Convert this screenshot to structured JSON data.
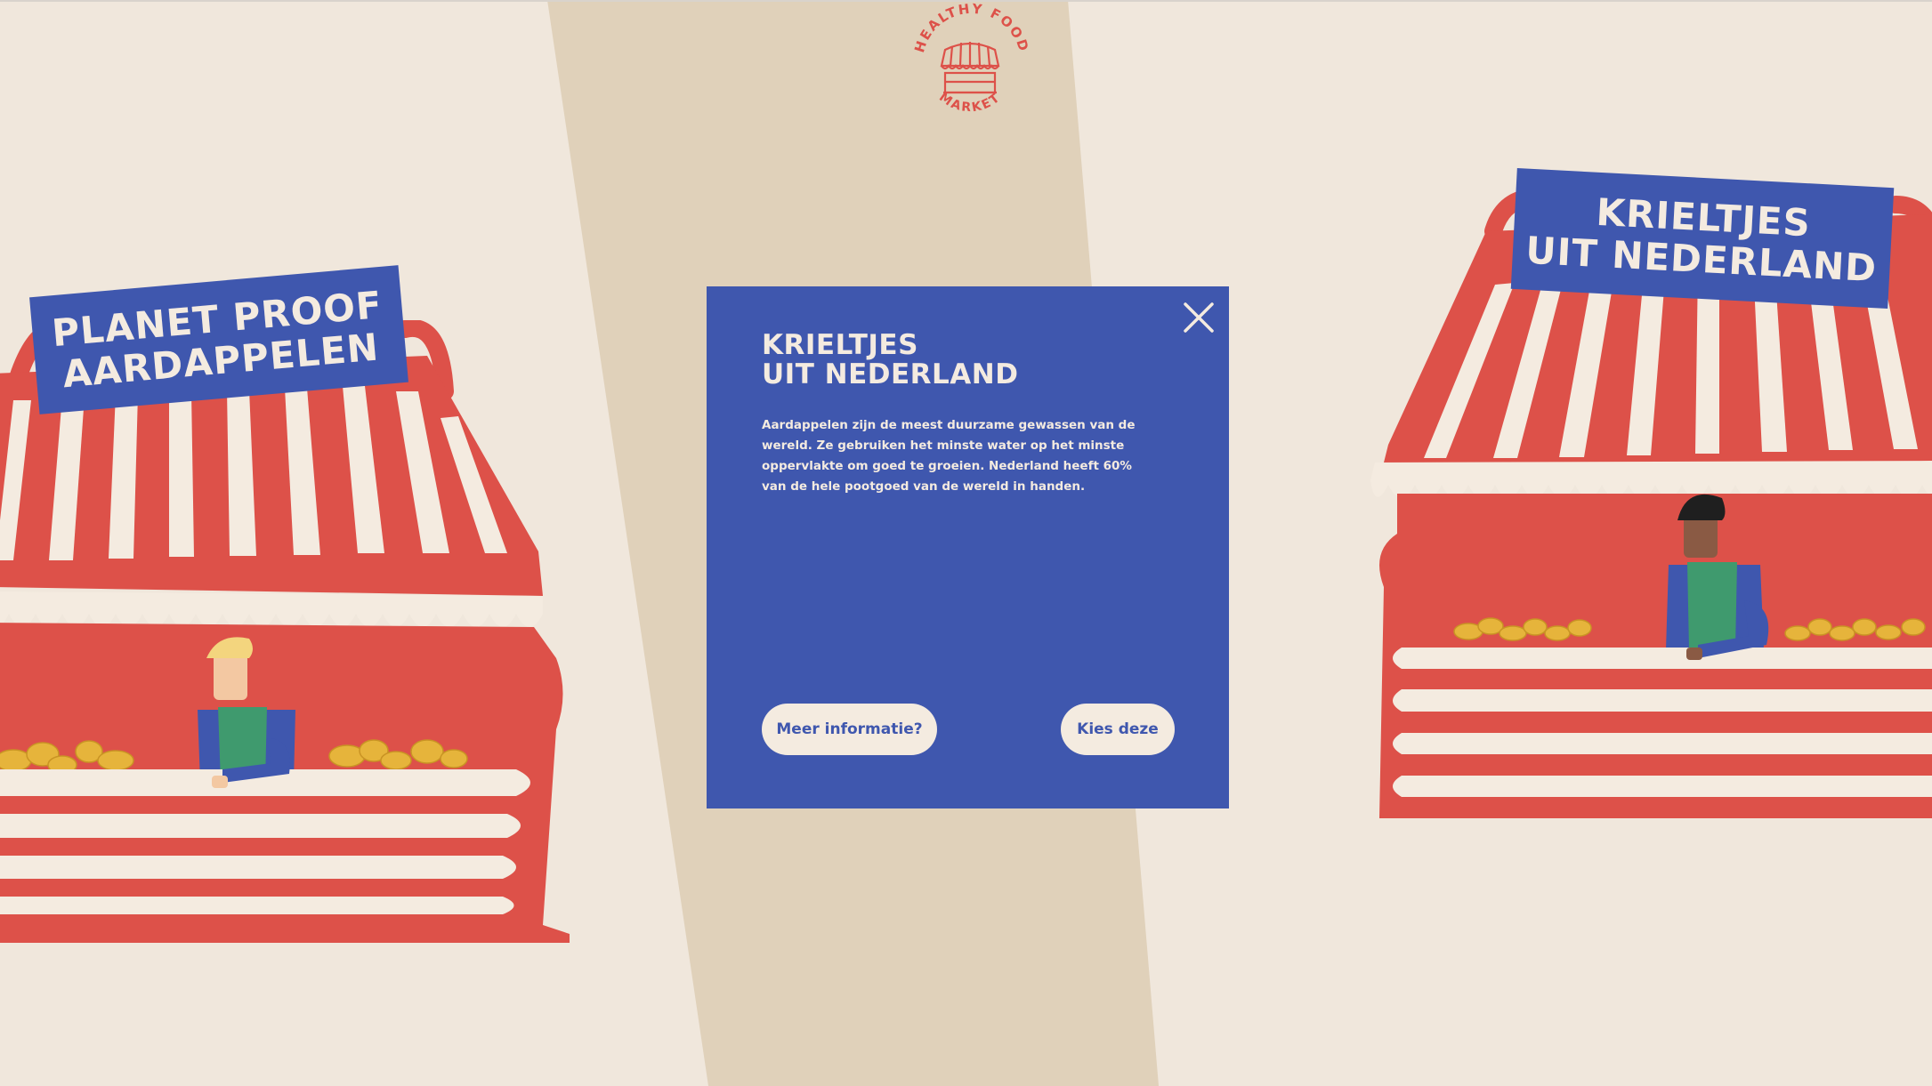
{
  "logo": {
    "top_text": "HEALTHY FOOD",
    "bottom_text": "MARKET",
    "icon": "market-stall-icon"
  },
  "stalls": [
    {
      "sign_lines": [
        "PLANET PROOF",
        "AARDAPPELEN"
      ]
    },
    {
      "sign_lines": [
        "KRIELTJES",
        "UIT NEDERLAND"
      ]
    }
  ],
  "modal": {
    "title_lines": [
      "KRIELTJES",
      "UIT NEDERLAND"
    ],
    "body": "Aardappelen zijn de meest duurzame gewassen van de wereld. Ze gebruiken het minste water op het minste oppervlakte om goed te groeien. Nederland heeft 60% van de hele pootgoed van de wereld in handen.",
    "more_info_label": "Meer informatie?",
    "choose_label": "Kies deze",
    "close_icon": "close-icon"
  },
  "colors": {
    "background": "#f0e7dc",
    "path": "#e0d1ba",
    "stall_red": "#dd5149",
    "modal_blue": "#3f57ae",
    "cream": "#f4ebe0",
    "potato": "#e6b43b",
    "apron": "#3f9a6e"
  }
}
